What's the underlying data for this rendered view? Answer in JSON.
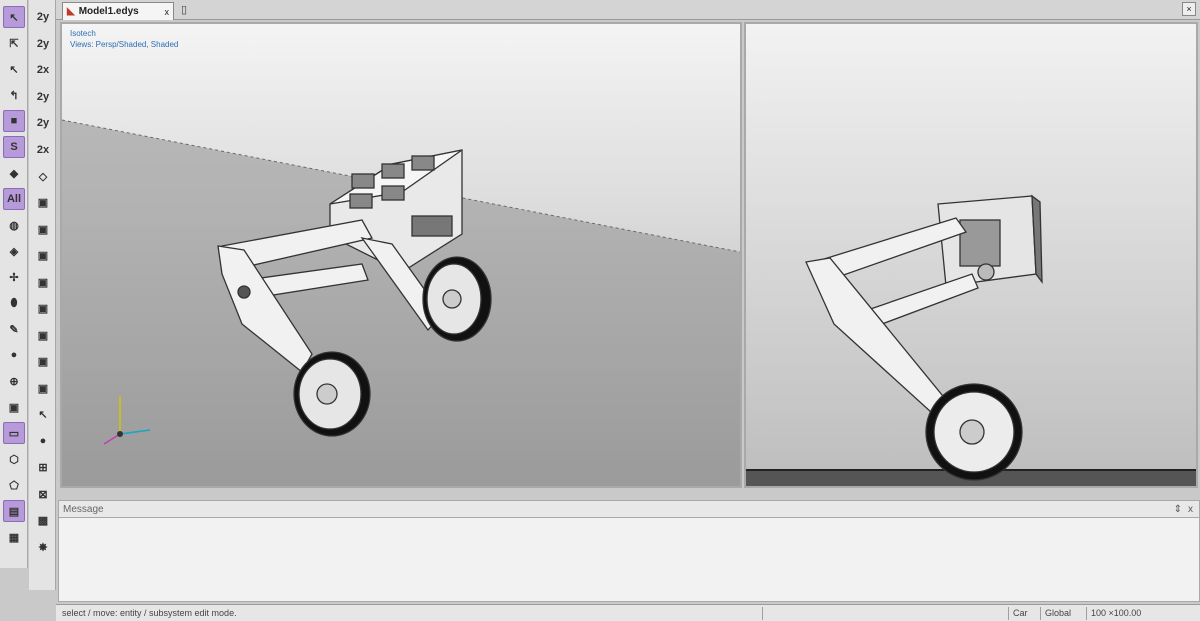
{
  "tab": {
    "title": "Model1.edys",
    "close": "x",
    "doc_icon": "document-icon"
  },
  "viewport_left": {
    "line1": "Isotech",
    "line2": "Views: Persp/Shaded, Shaded"
  },
  "message_panel": {
    "title": "Message",
    "pin": "⇕",
    "close": "x"
  },
  "status": {
    "text": "select / move: entity / subsystem edit mode.",
    "cell2": "",
    "cell3": "Car",
    "cell4": "Global",
    "cell5": "100 ×100.00"
  },
  "toolbar_left": [
    {
      "name": "select-arrow-icon",
      "glyph": "↖",
      "selected": true
    },
    {
      "name": "select-multi-icon",
      "glyph": "⇱",
      "selected": false
    },
    {
      "name": "move-icon",
      "glyph": "↖",
      "selected": false
    },
    {
      "name": "rotate-icon",
      "glyph": "↰",
      "selected": false
    },
    {
      "name": "body-icon",
      "glyph": "■",
      "selected": true
    },
    {
      "name": "joint-icon",
      "glyph": "S",
      "selected": true
    },
    {
      "name": "force-icon",
      "glyph": "◆",
      "selected": false
    },
    {
      "name": "all-icon",
      "glyph": "All",
      "selected": true
    },
    {
      "name": "marker-icon",
      "glyph": "◍",
      "selected": false
    },
    {
      "name": "color-cube-icon",
      "glyph": "◈",
      "selected": false
    },
    {
      "name": "axis-icon",
      "glyph": "✢",
      "selected": false
    },
    {
      "name": "pin-icon",
      "glyph": "⬮",
      "selected": false
    },
    {
      "name": "spring-icon",
      "glyph": "✎",
      "selected": false
    },
    {
      "name": "sphere-icon",
      "glyph": "●",
      "selected": false
    },
    {
      "name": "crosshair-icon",
      "glyph": "⊕",
      "selected": false
    },
    {
      "name": "box-icon",
      "glyph": "▣",
      "selected": false
    },
    {
      "name": "rectangle-icon",
      "glyph": "▭",
      "selected": true
    },
    {
      "name": "hexagon-icon",
      "glyph": "⬡",
      "selected": false
    },
    {
      "name": "pentagon-icon",
      "glyph": "⬠",
      "selected": false
    },
    {
      "name": "folder-icon",
      "glyph": "▤",
      "selected": true
    },
    {
      "name": "database-icon",
      "glyph": "▦",
      "selected": false
    }
  ],
  "toolbar_right": [
    {
      "name": "xy-plane-icon",
      "glyph": "2y"
    },
    {
      "name": "yz-plane-icon",
      "glyph": "2y"
    },
    {
      "name": "zx-plane-icon",
      "glyph": "2x"
    },
    {
      "name": "xy-plane-alt-icon",
      "glyph": "2y"
    },
    {
      "name": "yz-plane-alt-icon",
      "glyph": "2y"
    },
    {
      "name": "zx-plane-alt-icon",
      "glyph": "2x"
    },
    {
      "name": "iso-view-icon",
      "glyph": "◇"
    },
    {
      "name": "cube-front-icon",
      "glyph": "▣"
    },
    {
      "name": "cube-top-icon",
      "glyph": "▣"
    },
    {
      "name": "cube-side-icon",
      "glyph": "▣"
    },
    {
      "name": "cube-back-icon",
      "glyph": "▣"
    },
    {
      "name": "cube-bottom-icon",
      "glyph": "▣"
    },
    {
      "name": "cube-iso-icon",
      "glyph": "▣"
    },
    {
      "name": "cube-shaded-icon",
      "glyph": "▣"
    },
    {
      "name": "cube-wire-icon",
      "glyph": "▣"
    },
    {
      "name": "cursor-icon",
      "glyph": "↖"
    },
    {
      "name": "record-icon",
      "glyph": "●"
    },
    {
      "name": "grid-icon",
      "glyph": "⊞"
    },
    {
      "name": "pattern-icon",
      "glyph": "⊠"
    },
    {
      "name": "render-icon",
      "glyph": "▩"
    },
    {
      "name": "explode-icon",
      "glyph": "✸"
    }
  ],
  "colors": {
    "selected": "#b79ad9",
    "link_text": "#2d6fb3",
    "frame": "#a9a9a9"
  }
}
